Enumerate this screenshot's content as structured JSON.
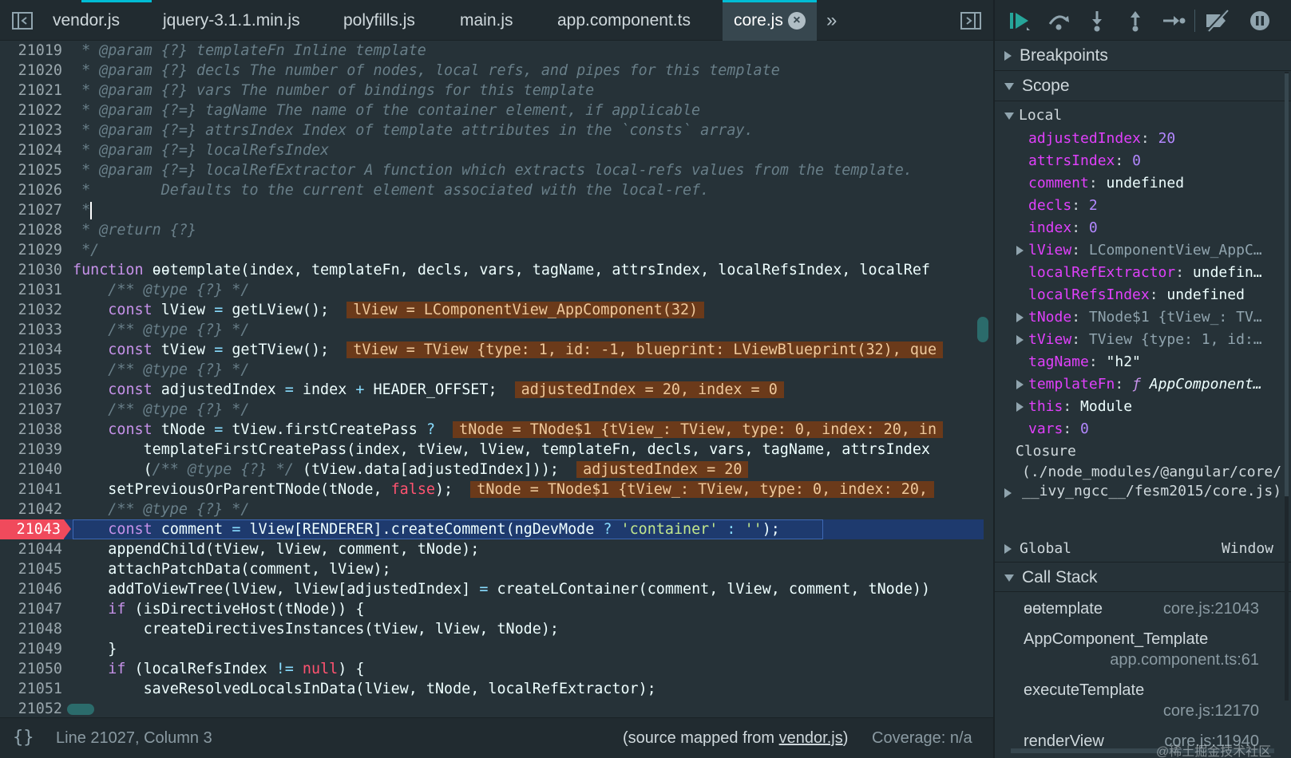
{
  "tabs": [
    {
      "label": "vendor.js"
    },
    {
      "label": "jquery-3.1.1.min.js"
    },
    {
      "label": "polyfills.js"
    },
    {
      "label": "main.js"
    },
    {
      "label": "app.component.ts"
    },
    {
      "label": "core.js",
      "active": true
    }
  ],
  "editor": {
    "line_numbers": [
      "21019",
      "21020",
      "21021",
      "21022",
      "21023",
      "21024",
      "21025",
      "21026",
      "21027",
      "21028",
      "21029",
      "21030",
      "21031",
      "21032",
      "21033",
      "21034",
      "21035",
      "21036",
      "21037",
      "21038",
      "21039",
      "21040",
      "21041",
      "21042",
      "21043",
      "21044",
      "21045",
      "21046",
      "21047",
      "21048",
      "21049",
      "21050",
      "21051",
      "21052"
    ],
    "execution_line": "21043",
    "inline_values": {
      "l21032": "lView = LComponentView_AppComponent(32)",
      "l21034": "tView = TView {type: 1, id: -1, blueprint: LViewBlueprint(32), que",
      "l21036": "adjustedIndex = 20, index = 0",
      "l21038": "tNode = TNode$1 {tView_: TView, type: 0, index: 20, in",
      "l21040": "adjustedIndex = 20",
      "l21041": "tNode = TNode$1 {tView_: TView, type: 0, index: 20,"
    }
  },
  "status_bar": {
    "pretty_print": "{}",
    "position": "Line 21027, Column 3",
    "source_prefix": "(source mapped from ",
    "source_link": "vendor.js",
    "source_suffix": ")",
    "coverage": "Coverage: n/a"
  },
  "debugger": {
    "sections": {
      "breakpoints": "Breakpoints",
      "scope": "Scope",
      "call_stack": "Call Stack"
    },
    "scope": {
      "local_label": "Local",
      "vars": [
        {
          "key": "adjustedIndex",
          "value": "20",
          "kind": "num"
        },
        {
          "key": "attrsIndex",
          "value": "0",
          "kind": "num"
        },
        {
          "key": "comment",
          "value": "undefined",
          "kind": "str"
        },
        {
          "key": "decls",
          "value": "2",
          "kind": "num"
        },
        {
          "key": "index",
          "value": "0",
          "kind": "num"
        },
        {
          "key": "lView",
          "value": "LComponentView_AppC…",
          "kind": "dim",
          "expandable": true
        },
        {
          "key": "localRefExtractor",
          "value": "undefin…",
          "kind": "str"
        },
        {
          "key": "localRefsIndex",
          "value": "undefined",
          "kind": "str"
        },
        {
          "key": "tNode",
          "value": "TNode$1 {tView_: TV…",
          "kind": "dim",
          "expandable": true
        },
        {
          "key": "tView",
          "value": "TView {type: 1, id:…",
          "kind": "dim",
          "expandable": true
        },
        {
          "key": "tagName",
          "value": "\"h2\"",
          "kind": "str"
        },
        {
          "key": "templateFn",
          "value": "AppComponent…",
          "kind": "fn",
          "expandable": true
        },
        {
          "key": "this",
          "value": "Module",
          "kind": "str",
          "expandable": true
        },
        {
          "key": "vars",
          "value": "0",
          "kind": "num"
        }
      ],
      "closure_label": "Closure",
      "closure_path": "(./node_modules/@angular/core/__ivy_ngcc__/fesm2015/core.js)",
      "global_label": "Global",
      "global_value": "Window"
    },
    "call_stack": [
      {
        "name": "ɵɵtemplate",
        "location": "core.js:21043"
      },
      {
        "name": "AppComponent_Template",
        "location": "app.component.ts:61"
      },
      {
        "name": "executeTemplate",
        "location": "core.js:12170"
      },
      {
        "name": "renderView",
        "location": "core.js:11940"
      }
    ],
    "watermark": "@稀土掘金技术社区"
  },
  "icons": {
    "sidebar_toggle": "sidebar-toggle-icon",
    "more_tabs": "double-chevron-right-icon",
    "resume": "resume-icon",
    "step_over": "step-over-icon",
    "step_into": "step-into-icon",
    "step_out": "step-out-icon",
    "step": "step-icon",
    "deactivate_breakpoints": "deactivate-breakpoints-icon",
    "pause_exceptions": "pause-on-exceptions-icon"
  },
  "colors": {
    "accent": "#00bcd4",
    "execution_marker": "#f04a5c",
    "execution_line_bg": "#1e3a6e",
    "inline_value_bg": "#6b3a1a"
  }
}
